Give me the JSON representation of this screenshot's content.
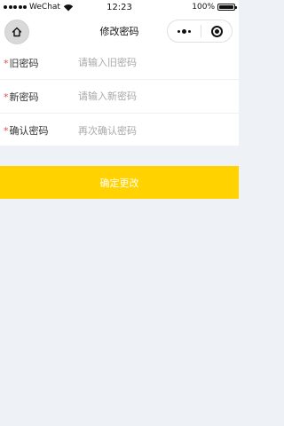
{
  "status_bar": {
    "carrier": "WeChat",
    "time": "12:23",
    "battery": "100%",
    "battery_level": 1.0,
    "signal_dots": 5,
    "icons": [
      "signal-dots-icon",
      "wifi-icon",
      "battery-icon"
    ]
  },
  "nav": {
    "title": "修改密码",
    "home_icon": "home-icon",
    "more_icon": "more-dots-icon",
    "close_icon": "target-close-icon"
  },
  "form": {
    "required_mark": "*",
    "fields": [
      {
        "label": "旧密码",
        "placeholder": "请输入旧密码",
        "value": ""
      },
      {
        "label": "新密码",
        "placeholder": "请输入新密码",
        "value": ""
      },
      {
        "label": "确认密码",
        "placeholder": "再次确认密码",
        "value": ""
      }
    ]
  },
  "actions": {
    "submit_label": "确定更改"
  },
  "colors": {
    "accent": "#ffd200",
    "required": "#e24b4b",
    "page_background": "#eef1f5",
    "placeholder": "#a8a8a8"
  }
}
